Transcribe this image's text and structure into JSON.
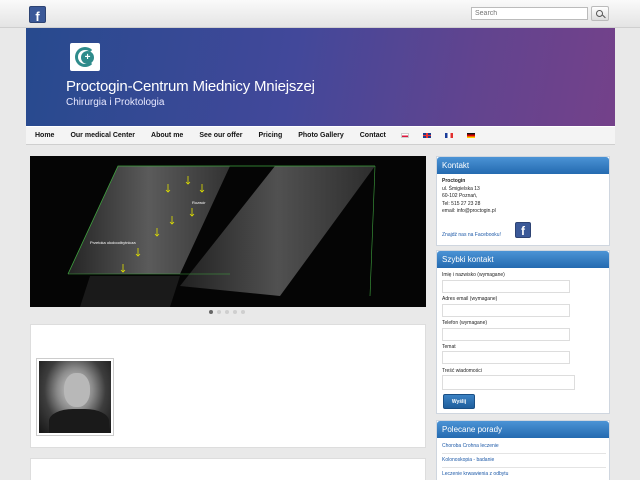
{
  "topbar": {
    "facebook_icon": "facebook-icon",
    "search_placeholder": "Search",
    "search_button_icon": "search-icon"
  },
  "header": {
    "title": "Proctogin-Centrum Miednicy Mniejszej",
    "subtitle": "Chirurgia i Proktologia",
    "logo_icon": "clinic-logo-icon",
    "gradient_colors": [
      "#274a8e",
      "#74418a"
    ]
  },
  "nav": {
    "items": [
      {
        "label": "Home"
      },
      {
        "label": "Our medical Center"
      },
      {
        "label": "About me"
      },
      {
        "label": "See our offer"
      },
      {
        "label": "Pricing"
      },
      {
        "label": "Photo Gallery"
      },
      {
        "label": "Contact"
      }
    ],
    "flags": [
      "flag-pl-icon",
      "flag-en-icon",
      "flag-fr-icon",
      "flag-de-icon"
    ]
  },
  "slider": {
    "label_1": "Rozwór",
    "label_2": "Przetoka okołoodbytnicza",
    "dots": 5,
    "active_dot": 1
  },
  "kontakt": {
    "title": "Kontakt",
    "name": "Proctogin",
    "street": "ul. Śmigielska 13",
    "city": "60-102 Poznań,",
    "phone": "Tel: 515 27 23 28",
    "email": "email: info@proctogin.pl",
    "facebook_link": "Znajdź nas na Facebooku!"
  },
  "szybki_kontakt": {
    "title": "Szybki kontakt",
    "fields": [
      {
        "label": "Imię i nazwisko (wymagane)"
      },
      {
        "label": "Adres email (wymagane)"
      },
      {
        "label": "Telefon (wymagane)"
      },
      {
        "label": "Temat"
      },
      {
        "label": "Treść wiadomości"
      }
    ],
    "submit_label": "Wyślij"
  },
  "polecane": {
    "title": "Polecane porady",
    "links": [
      "Choroba Crohna leczenie",
      "Kolonoskopia - badanie",
      "Leczenie krwawienia z odbytu"
    ]
  }
}
